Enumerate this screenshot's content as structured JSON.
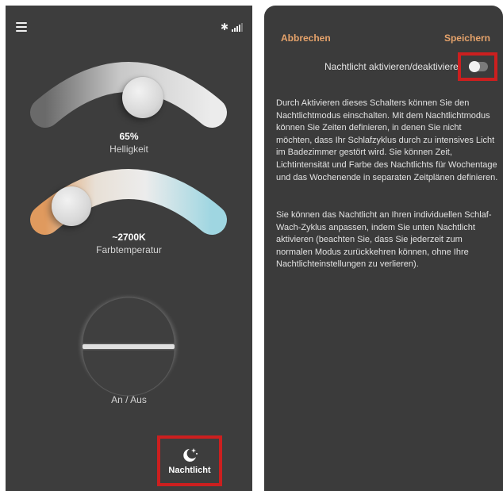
{
  "left": {
    "brightness": {
      "value": "65%",
      "label": "Helligkeit",
      "level": 0.65
    },
    "color_temp": {
      "value": "~2700K",
      "label": "Farbtemperatur"
    },
    "power": {
      "label": "An / Aus"
    },
    "nightlight_button": {
      "label": "Nachtlicht"
    },
    "icons": {
      "menu": "menu-icon",
      "bluetooth": "bluetooth-icon",
      "signal": "signal-icon",
      "moon": "moon-stars-icon"
    }
  },
  "right": {
    "cancel_label": "Abbrechen",
    "save_label": "Speichern",
    "toggle_label": "Nachtlicht aktivieren/deaktivieren",
    "toggle_on": false,
    "paragraph1": "Durch Aktivieren dieses Schalters können Sie den Nachtlichtmodus einschalten. Mit dem Nachtlichtmodus können Sie Zeiten definieren, in denen Sie nicht möchten, dass Ihr Schlafzyklus durch zu intensives Licht im Badezimmer gestört wird. Sie können Zeit, Lichtintensität und Farbe des Nachtlichts für Wochentage und das Wochenende in separaten Zeitplänen definieren.",
    "paragraph2": "Sie können das Nachtlicht an Ihren individuellen Schlaf-Wach-Zyklus anpassen, indem Sie unten Nachtlicht aktivieren (beachten Sie, dass Sie jederzeit zum normalen Modus zurückkehren können, ohne Ihre Nachtlichteinstellungen zu verlieren)."
  },
  "colors": {
    "accent": "#e6a36b",
    "highlight": "#cc1f1f",
    "warm": "#e0a16a",
    "cool": "#a8d9e3"
  }
}
